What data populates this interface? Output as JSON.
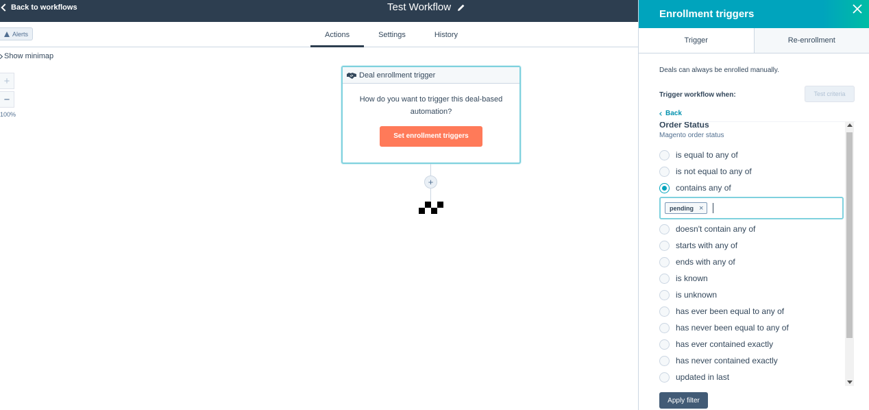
{
  "topbar": {
    "back_label": "Back to workflows",
    "workflow_title": "Test Workflow"
  },
  "subbar": {
    "alerts_label": "Alerts",
    "tabs": [
      {
        "label": "Actions"
      },
      {
        "label": "Settings"
      },
      {
        "label": "History"
      }
    ]
  },
  "canvas": {
    "minimap_label": "Show minimap",
    "zoom_in": "+",
    "zoom_out": "−",
    "zoom_level": "100%",
    "card_title": "Deal enrollment trigger",
    "card_question": "How do you want to trigger this deal-based automation?",
    "card_button": "Set enrollment triggers",
    "add_action": "+"
  },
  "panel": {
    "title": "Enrollment triggers",
    "tabs": [
      {
        "label": "Trigger"
      },
      {
        "label": "Re-enrollment"
      }
    ],
    "manual_note": "Deals can always be enrolled manually.",
    "trigger_when": "Trigger workflow when:",
    "test_criteria": "Test criteria",
    "back_label": "Back",
    "property_name": "Order Status",
    "property_desc": "Magento order status",
    "options": [
      {
        "label": "is equal to any of",
        "checked": false
      },
      {
        "label": "is not equal to any of",
        "checked": false
      },
      {
        "label": "contains any of",
        "checked": true
      },
      {
        "label": "doesn't contain any of",
        "checked": false
      },
      {
        "label": "starts with any of",
        "checked": false
      },
      {
        "label": "ends with any of",
        "checked": false
      },
      {
        "label": "is known",
        "checked": false
      },
      {
        "label": "is unknown",
        "checked": false
      },
      {
        "label": "has ever been equal to any of",
        "checked": false
      },
      {
        "label": "has never been equal to any of",
        "checked": false
      },
      {
        "label": "has ever contained exactly",
        "checked": false
      },
      {
        "label": "has never contained exactly",
        "checked": false
      },
      {
        "label": "updated in last",
        "checked": false
      }
    ],
    "tag_value": "pending",
    "tag_remove": "×",
    "apply_label": "Apply filter"
  },
  "colors": {
    "topbar": "#2d3e50",
    "accent": "#00a4bd",
    "cta": "#ff7a59",
    "apply": "#425b76"
  }
}
